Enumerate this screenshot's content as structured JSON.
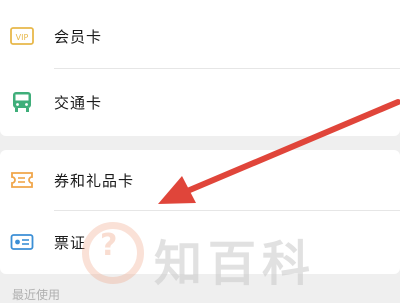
{
  "menu": {
    "items": [
      {
        "label": "会员卡",
        "icon": "vip-card-icon"
      },
      {
        "label": "交通卡",
        "icon": "bus-icon"
      },
      {
        "label": "券和礼品卡",
        "icon": "coupon-icon"
      },
      {
        "label": "票证",
        "icon": "id-card-icon"
      }
    ]
  },
  "footer_hint": "最近使用",
  "watermark": "知百科",
  "colors": {
    "vip": "#e8b84a",
    "bus": "#3fae7a",
    "coupon": "#f0a64a",
    "ticket": "#3b8fd6",
    "arrow": "#e0453a"
  }
}
